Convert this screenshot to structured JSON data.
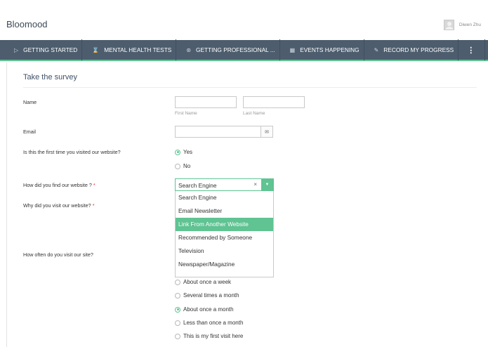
{
  "header": {
    "brand": "Bloomood",
    "user_name": "Diwen Zhu"
  },
  "nav": {
    "items": [
      {
        "label": "GETTING STARTED",
        "icon": "▷"
      },
      {
        "label": "MENTAL HEALTH TESTS",
        "icon": "⌛"
      },
      {
        "label": "GETTING PROFESSIONAL ...",
        "icon": "⊛"
      },
      {
        "label": "EVENTS HAPPENING",
        "icon": "▦"
      },
      {
        "label": "RECORD MY PROGRESS",
        "icon": "✎"
      }
    ],
    "more_icon": "⋮"
  },
  "survey": {
    "title": "Take the survey",
    "name": {
      "label": "Name",
      "first_sublabel": "First Name",
      "last_sublabel": "Last Name",
      "first_value": "",
      "last_value": ""
    },
    "email": {
      "label": "Email",
      "value": "",
      "icon": "✉"
    },
    "first_visit": {
      "label": "Is this the first time you visited our website?",
      "options": [
        "Yes",
        "No"
      ],
      "selected": "Yes"
    },
    "find": {
      "label": "How did you find our website ?",
      "required_mark": "*",
      "value": "Search Engine",
      "clear_icon": "×",
      "arrow_icon": "▼",
      "options": [
        "Search Engine",
        "Email Newsletter",
        "Link From Another Website",
        "Recommended by Someone",
        "Television",
        "Newspaper/Magazine"
      ],
      "highlighted": "Link From Another Website"
    },
    "why": {
      "label": "Why did you visit our website?",
      "required_mark": "*"
    },
    "often": {
      "label": "How often do you visit our site?",
      "options": [
        "About once a week",
        "Several times a month",
        "About once a month",
        "Less than once a month",
        "This is my first visit here"
      ],
      "selected": "About once a month"
    }
  }
}
